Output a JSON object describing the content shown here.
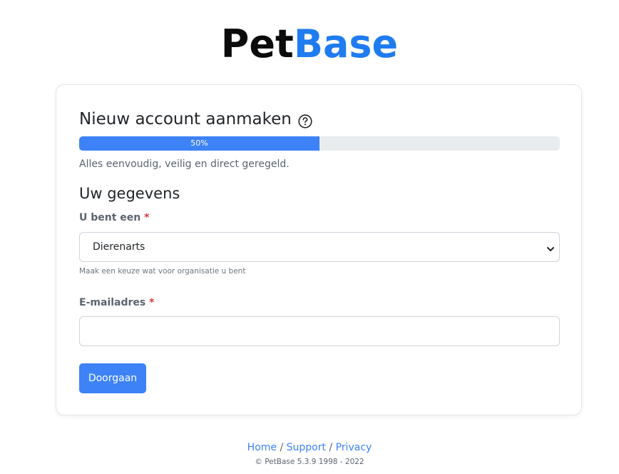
{
  "logo": {
    "part1": "Pet",
    "part2": "Base",
    "color_dark": "#0b0b0b",
    "color_brand": "#1f7cf0"
  },
  "card": {
    "title": "Nieuw account aanmaken",
    "help_icon": "question-circle-icon",
    "progress": {
      "percent": 50,
      "label": "50%"
    },
    "subtitle": "Alles eenvoudig, veilig en direct geregeld.",
    "section_title": "Uw gegevens",
    "type_field": {
      "label": "U bent een",
      "required_mark": "*",
      "value": "Dierenarts",
      "hint": "Maak een keuze wat voor organisatie u bent"
    },
    "email_field": {
      "label": "E-mailadres",
      "required_mark": "*",
      "value": ""
    },
    "submit_label": "Doorgaan"
  },
  "footer": {
    "links": [
      "Home",
      "Support",
      "Privacy"
    ],
    "separator": "/",
    "copyright": "© PetBase 5.3.9 1998 - 2022"
  },
  "colors": {
    "accent": "#3d82f6",
    "required": "#dc3545",
    "muted_text": "#5b6470"
  }
}
